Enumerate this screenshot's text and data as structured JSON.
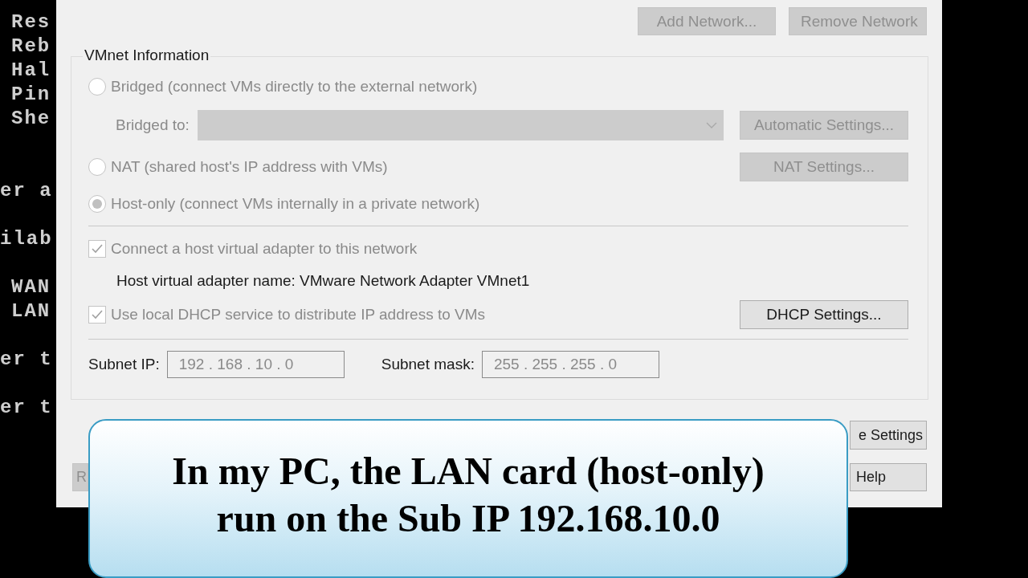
{
  "console_lines": [
    {
      "text": "Res",
      "indent": true
    },
    {
      "text": "Reb",
      "indent": true
    },
    {
      "text": "Hal",
      "indent": true
    },
    {
      "text": "Pin",
      "indent": true
    },
    {
      "text": "She",
      "indent": true
    },
    {
      "text": "er a",
      "indent": false
    },
    {
      "text": "ilab",
      "indent": false
    },
    {
      "text": "WAN",
      "indent": true
    },
    {
      "text": "LAN",
      "indent": true
    },
    {
      "text": "er t",
      "indent": false
    },
    {
      "text": "er t",
      "indent": false
    }
  ],
  "dialog": {
    "top_buttons": [
      {
        "label": "Add Network...",
        "disabled": true
      },
      {
        "label": "Remove Network",
        "disabled": true
      }
    ],
    "group": {
      "title": "VMnet Information",
      "bridged": {
        "label": "Bridged (connect VMs directly to the external network)",
        "selected": false,
        "disabled": true
      },
      "bridged_to": {
        "label": "Bridged to:",
        "disabled": true,
        "button": {
          "label": "Automatic Settings...",
          "disabled": true
        }
      },
      "nat": {
        "label": "NAT (shared host's IP address with VMs)",
        "selected": false,
        "disabled": true,
        "button": {
          "label": "NAT Settings...",
          "disabled": true
        }
      },
      "host_only": {
        "label": "Host-only (connect VMs internally in a private network)",
        "selected": true,
        "disabled": true
      },
      "connect_adapter": {
        "label": "Connect a host virtual adapter to this network",
        "checked": true,
        "disabled": true
      },
      "adapter_name": "Host virtual adapter name: VMware Network Adapter VMnet1",
      "dhcp": {
        "label": "Use local DHCP service to distribute IP address to VMs",
        "checked": true,
        "disabled": true,
        "button": {
          "label": "DHCP Settings...",
          "disabled": false
        }
      },
      "subnet_ip": {
        "label": "Subnet IP:",
        "value": "192 . 168 . 10 . 0"
      },
      "subnet_mask": {
        "label": "Subnet mask:",
        "value": "255 . 255 . 255 . 0"
      }
    },
    "bottom_buttons": [
      {
        "label": "R",
        "disabled": true
      },
      {
        "label": "e Settings",
        "disabled": false
      },
      {
        "label": "Help",
        "disabled": false
      }
    ]
  },
  "caption": {
    "lines": [
      "In my PC, the LAN card (host-only)",
      "run on the Sub IP 192.168.10.0"
    ]
  }
}
